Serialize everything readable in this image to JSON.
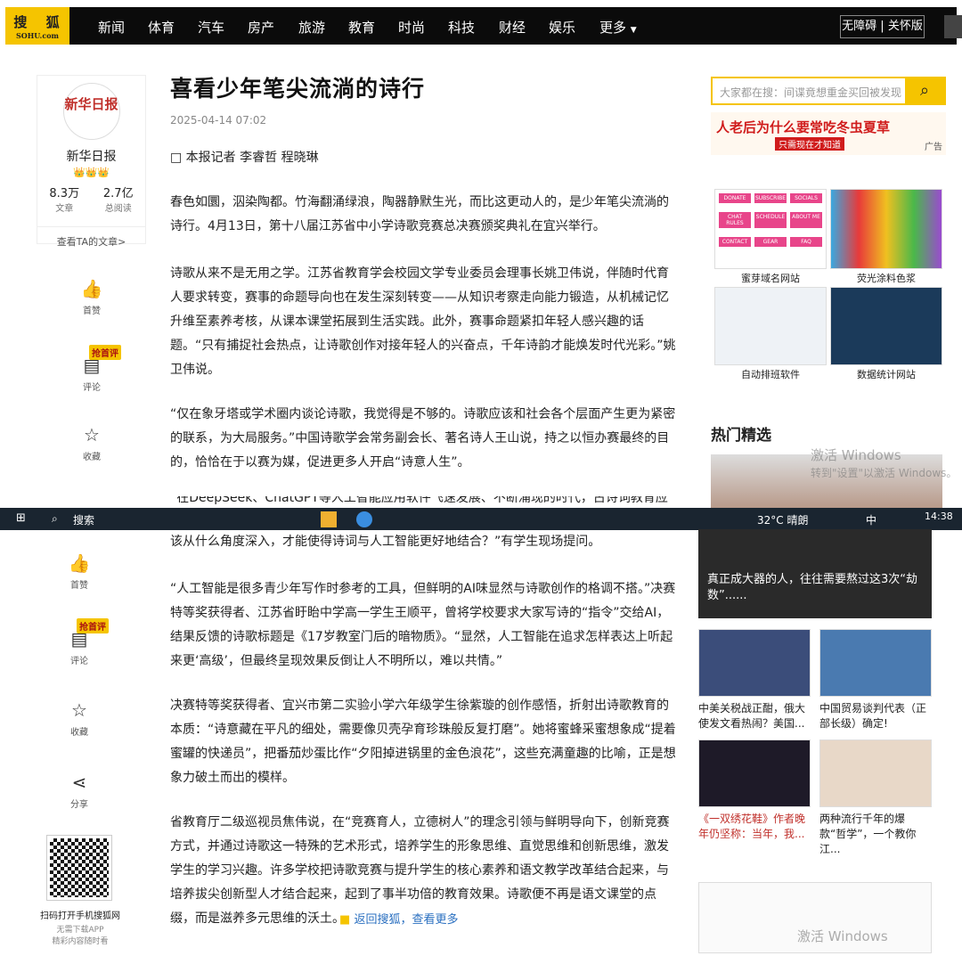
{
  "nav": {
    "logo_top": "搜 狐",
    "logo_bottom": "SOHU.com",
    "items": [
      "新闻",
      "体育",
      "汽车",
      "房产",
      "旅游",
      "教育",
      "时尚",
      "科技",
      "财经",
      "娱乐",
      "更多"
    ],
    "accessibility": "无障碍 | 关怀版"
  },
  "author": {
    "logo_text": "新华日报",
    "name": "新华日报",
    "articles_num": "8.3万",
    "articles_lbl": "文章",
    "reads_num": "2.7亿",
    "reads_lbl": "总阅读",
    "view_more": "查看TA的文章>"
  },
  "actions": {
    "like": "首赞",
    "comment_badge": "抢首评",
    "comment": "评论",
    "collect": "收藏",
    "share": "分享"
  },
  "article": {
    "title": "喜看少年笔尖流淌的诗行",
    "date": "2025-04-14 07:02",
    "byline": "□ 本报记者 李睿哲 程晓琳",
    "p1": "春色如圜，泅染陶都。竹海翻涌绿浪，陶器静默生光，而比这更动人的，是少年笔尖流淌的诗行。4月13日，第十八届江苏省中小学诗歌竞赛总决赛颁奖典礼在宜兴举行。",
    "p2": "诗歌从来不是无用之学。江苏省教育学会校园文学专业委员会理事长姚卫伟说，伴随时代育人要求转变，赛事的命题导向也在发生深刻转变——从知识考察走向能力锻造，从机械记忆升维至素养考核，从课本课堂拓展到生活实践。此外，赛事命题紧扣年轻人感兴趣的话题。“只有捕捉社会热点，让诗歌创作对接年轻人的兴奋点，千年诗韵才能焕发时代光彩。”姚卫伟说。",
    "p3": "“仅在象牙塔或学术圈内谈论诗歌，我觉得是不够的。诗歌应该和社会各个层面产生更为紧密的联系，为大局服务。”中国诗歌学会常务副会长、著名诗人王山说，持之以恒办赛最终的目的，恰恰在于以赛为媒，促进更多人开启“诗意人生”。",
    "p4_partial": "“在DeepSeek、ChatGPT等人工智能应用软件飞速发展、不断涌现的时代，古诗词教育应",
    "p4_cont": "该从什么角度深入，才能使得诗词与人工智能更好地结合？”有学生现场提问。",
    "p5": "“人工智能是很多青少年写作时参考的工具，但鲜明的AI味显然与诗歌创作的格调不搭。”决赛特等奖获得者、江苏省盱眙中学高一学生王顺平，曾将学校要求大家写诗的“指令”交给AI，结果反馈的诗歌标题是《17岁教室门后的暗物质》。“显然，人工智能在追求怎样表达上听起来更‘高级’，但最终呈现效果反倒让人不明所以，难以共情。”",
    "p6": "决赛特等奖获得者、宜兴市第二实验小学六年级学生徐紫璇的创作感悟，折射出诗歌教育的本质：“诗意藏在平凡的细处，需要像贝壳孕育珍珠般反复打磨”。她将蜜蜂采蜜想象成“提着蜜罐的快递员”，把番茄炒蛋比作“夕阳掉进锅里的金色浪花”，这些充满童趣的比喻，正是想象力破土而出的模样。",
    "p7": "省教育厅二级巡视员焦伟说，在“竞赛育人，立德树人”的理念引领与鲜明导向下，创新竞赛方式，并通过诗歌这一特殊的艺术形式，培养学生的形象思维、直觉思维和创新思维，激发学生的学习兴趣。许多学校把诗歌竞赛与提升学生的核心素养和语文教学改革结合起来，与培养拔尖创新型人才结合起来，起到了事半功倍的教育效果。诗歌便不再是语文课堂的点缀，而是滋养多元思维的沃土。",
    "back_link": "返回搜狐，查看更多"
  },
  "sidebar": {
    "search_placeholder": "大家都在搜：间谍竟想重金买回被发现",
    "ad_text": "人老后为什么要常吃冬虫夏草",
    "ad_sub": "只需现在才知道",
    "ad_label": "广告",
    "tiles": [
      {
        "cap": "蜜芽域名网站"
      },
      {
        "cap": "荧光涂料色浆"
      },
      {
        "cap": "自动排班软件"
      },
      {
        "cap": "数据统计网站"
      }
    ],
    "tile_buttons": [
      "DONATE",
      "SUBSCRIBE",
      "SOCIALS",
      "CHAT RULES",
      "SCHEDULE",
      "ABOUT ME",
      "CONTACT",
      "GEAR",
      "FAQ"
    ],
    "hot_title": "热门精选",
    "banner_title": "真正成大器的人，往往需要熬过这3次“劫数”......",
    "news": [
      {
        "cap": "中美关税战正酣，俄大使发文看热闹？美国..."
      },
      {
        "cap": "中国贸易谈判代表（正部长级）确定!"
      },
      {
        "cap": "《一双绣花鞋》作者晚年仍坚称：当年，我..."
      },
      {
        "cap": "两种流行千年的爆款“哲学”，一个教你江..."
      }
    ]
  },
  "taskbar": {
    "search": "搜索",
    "weather": "32°C 晴朗",
    "ime": "中",
    "time": "14:38"
  },
  "qr": {
    "line1": "扫码打开手机搜狐网",
    "line2": "无需下载APP",
    "line3": "精彩内容随时看"
  },
  "watermark": {
    "w1": "激活 Windows",
    "w2": "转到\"设置\"以激活 Windows。"
  }
}
